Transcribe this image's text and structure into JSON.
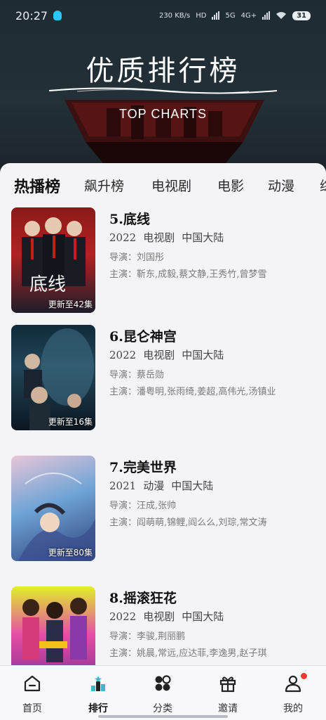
{
  "status": {
    "time": "20:27",
    "net_speed": "230 KB/s",
    "net_labels": [
      "HD",
      "5G",
      "4G+"
    ],
    "battery": "31"
  },
  "banner": {
    "title": "优质排行榜",
    "subtitle": "TOP CHARTS"
  },
  "tabs": [
    "热播榜",
    "飙升榜",
    "电视剧",
    "电影",
    "动漫",
    "综"
  ],
  "items": [
    {
      "title": "5.底线",
      "year": "2022",
      "type": "电视剧",
      "region": "中国大陆",
      "director": "导演：刘国彤",
      "cast": "主演：靳东,成毅,蔡文静,王秀竹,曾梦雪",
      "badge": "更新至42集",
      "poster_text": "底线"
    },
    {
      "title": "6.昆仑神宫",
      "year": "2022",
      "type": "电视剧",
      "region": "中国大陆",
      "director": "导演：蔡岳勋",
      "cast": "主演：潘粤明,张雨绮,姜超,高伟光,汤镇业",
      "badge": "更新至16集",
      "poster_text": ""
    },
    {
      "title": "7.完美世界",
      "year": "2021",
      "type": "动漫",
      "region": "中国大陆",
      "director": "导演：汪成,张帅",
      "cast": "主演：阎萌萌,锦鲤,阎么么,刘琮,常文涛",
      "badge": "更新至80集",
      "poster_text": ""
    },
    {
      "title": "8.摇滚狂花",
      "year": "2022",
      "type": "电视剧",
      "region": "中国大陆",
      "director": "导演：李骏,荆丽鹏",
      "cast": "主演：姚晨,常远,应达菲,李逸男,赵子琪",
      "badge": "",
      "poster_text": ""
    }
  ],
  "nav": [
    {
      "label": "首页",
      "icon": "home-icon"
    },
    {
      "label": "排行",
      "icon": "ranking-icon"
    },
    {
      "label": "分类",
      "icon": "category-icon"
    },
    {
      "label": "邀请",
      "icon": "gift-icon"
    },
    {
      "label": "我的",
      "icon": "profile-icon"
    }
  ],
  "colors": {
    "banner_bg": "#233038",
    "accent_red": "#ee3b2f",
    "text_dark": "#111111",
    "text_muted": "#7a7a7a"
  }
}
